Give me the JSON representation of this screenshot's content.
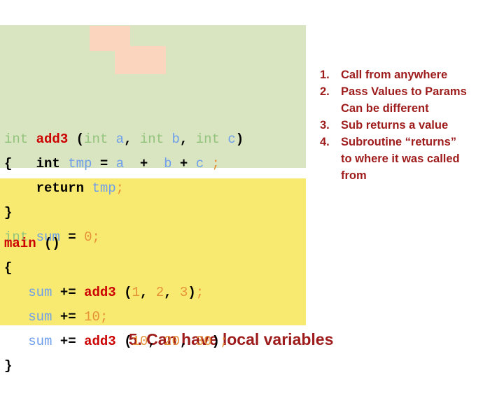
{
  "colors": {
    "func_block_bg": "#d9e4c0",
    "main_block_bg": "#f8ea70",
    "highlight_bg": "#fbd5bd",
    "note_text": "#9e1b1b",
    "type_keyword": "#93c47d",
    "function_name": "#cc0000",
    "variable": "#6d9eeb",
    "number": "#e69138",
    "punctuation": "#000000"
  },
  "code_function": {
    "lines": [
      {
        "id": "sig",
        "tokens": [
          {
            "text": "int",
            "cls": "t-type"
          },
          {
            "text": " ",
            "cls": "t-plain"
          },
          {
            "text": "add3",
            "cls": "t-fn"
          },
          {
            "text": " ",
            "cls": "t-plain"
          },
          {
            "text": "(",
            "cls": "t-punct"
          },
          {
            "text": "int",
            "cls": "t-type"
          },
          {
            "text": " ",
            "cls": "t-plain"
          },
          {
            "text": "a",
            "cls": "t-var"
          },
          {
            "text": ",",
            "cls": "t-punct"
          },
          {
            "text": " ",
            "cls": "t-plain"
          },
          {
            "text": "int",
            "cls": "t-type"
          },
          {
            "text": " ",
            "cls": "t-plain"
          },
          {
            "text": "b",
            "cls": "t-var"
          },
          {
            "text": ",",
            "cls": "t-punct"
          },
          {
            "text": " ",
            "cls": "t-plain"
          },
          {
            "text": "int",
            "cls": "t-type"
          },
          {
            "text": " ",
            "cls": "t-plain"
          },
          {
            "text": "c",
            "cls": "t-var"
          },
          {
            "text": ")",
            "cls": "t-punct"
          }
        ]
      },
      {
        "id": "decl",
        "tokens": [
          {
            "text": "{",
            "cls": "t-punct"
          },
          {
            "text": "   ",
            "cls": "t-plain"
          },
          {
            "text": "int",
            "cls": "t-kw"
          },
          {
            "text": " ",
            "cls": "t-plain"
          },
          {
            "text": "tmp",
            "cls": "t-var"
          },
          {
            "text": " = ",
            "cls": "t-op"
          },
          {
            "text": "a",
            "cls": "t-var"
          },
          {
            "text": "  +  ",
            "cls": "t-op"
          },
          {
            "text": "b",
            "cls": "t-var"
          },
          {
            "text": " + ",
            "cls": "t-op"
          },
          {
            "text": "c",
            "cls": "t-var"
          },
          {
            "text": " ",
            "cls": "t-plain"
          },
          {
            "text": ";",
            "cls": "t-semi"
          }
        ]
      },
      {
        "id": "return",
        "tokens": [
          {
            "text": "    ",
            "cls": "t-plain"
          },
          {
            "text": "return",
            "cls": "t-kw"
          },
          {
            "text": " ",
            "cls": "t-plain"
          },
          {
            "text": "tmp",
            "cls": "t-var"
          },
          {
            "text": ";",
            "cls": "t-semi"
          }
        ]
      },
      {
        "id": "close",
        "tokens": [
          {
            "text": "}",
            "cls": "t-punct"
          }
        ]
      },
      {
        "id": "global",
        "tokens": [
          {
            "text": "int",
            "cls": "t-type"
          },
          {
            "text": " ",
            "cls": "t-plain"
          },
          {
            "text": "sum",
            "cls": "t-var"
          },
          {
            "text": " = ",
            "cls": "t-op"
          },
          {
            "text": "0",
            "cls": "t-num"
          },
          {
            "text": ";",
            "cls": "t-semi"
          }
        ]
      }
    ]
  },
  "code_main": {
    "lines": [
      {
        "id": "main-sig",
        "tokens": [
          {
            "text": "main",
            "cls": "t-fn"
          },
          {
            "text": " ",
            "cls": "t-plain"
          },
          {
            "text": "()",
            "cls": "t-punct"
          }
        ]
      },
      {
        "id": "main-open",
        "tokens": [
          {
            "text": "{",
            "cls": "t-punct"
          }
        ]
      },
      {
        "id": "call1",
        "tokens": [
          {
            "text": "   ",
            "cls": "t-plain"
          },
          {
            "text": "sum",
            "cls": "t-var"
          },
          {
            "text": " ",
            "cls": "t-plain"
          },
          {
            "text": "+=",
            "cls": "t-op"
          },
          {
            "text": " ",
            "cls": "t-plain"
          },
          {
            "text": "add3",
            "cls": "t-fn"
          },
          {
            "text": " ",
            "cls": "t-plain"
          },
          {
            "text": "(",
            "cls": "t-punct"
          },
          {
            "text": "1",
            "cls": "t-num"
          },
          {
            "text": ",",
            "cls": "t-punct"
          },
          {
            "text": " ",
            "cls": "t-plain"
          },
          {
            "text": "2",
            "cls": "t-num"
          },
          {
            "text": ",",
            "cls": "t-punct"
          },
          {
            "text": " ",
            "cls": "t-plain"
          },
          {
            "text": "3",
            "cls": "t-num"
          },
          {
            "text": ")",
            "cls": "t-punct"
          },
          {
            "text": ";",
            "cls": "t-semi"
          }
        ]
      },
      {
        "id": "call2",
        "tokens": [
          {
            "text": "   ",
            "cls": "t-plain"
          },
          {
            "text": "sum",
            "cls": "t-var"
          },
          {
            "text": " ",
            "cls": "t-plain"
          },
          {
            "text": "+=",
            "cls": "t-op"
          },
          {
            "text": " ",
            "cls": "t-plain"
          },
          {
            "text": "10",
            "cls": "t-num"
          },
          {
            "text": ";",
            "cls": "t-semi"
          }
        ]
      },
      {
        "id": "call3",
        "tokens": [
          {
            "text": "   ",
            "cls": "t-plain"
          },
          {
            "text": "sum",
            "cls": "t-var"
          },
          {
            "text": " ",
            "cls": "t-plain"
          },
          {
            "text": "+=",
            "cls": "t-op"
          },
          {
            "text": " ",
            "cls": "t-plain"
          },
          {
            "text": "add3",
            "cls": "t-fn"
          },
          {
            "text": " ",
            "cls": "t-plain"
          },
          {
            "text": "(",
            "cls": "t-punct"
          },
          {
            "text": "10",
            "cls": "t-num"
          },
          {
            "text": ",",
            "cls": "t-punct"
          },
          {
            "text": " ",
            "cls": "t-plain"
          },
          {
            "text": "20",
            "cls": "t-num"
          },
          {
            "text": ",",
            "cls": "t-punct"
          },
          {
            "text": " ",
            "cls": "t-plain"
          },
          {
            "text": "30",
            "cls": "t-num"
          },
          {
            "text": ")",
            "cls": "t-punct"
          },
          {
            "text": ";",
            "cls": "t-semi"
          }
        ]
      },
      {
        "id": "main-close",
        "tokens": [
          {
            "text": "}",
            "cls": "t-punct"
          }
        ]
      }
    ]
  },
  "notes": {
    "items": [
      {
        "number": "1.",
        "text": "Call from anywhere",
        "continuations": []
      },
      {
        "number": "2.",
        "text": "Pass Values to Params",
        "continuations": [
          "Can be different"
        ]
      },
      {
        "number": "3.",
        "text": "Sub returns a value",
        "continuations": []
      },
      {
        "number": "4.",
        "text": "Subroutine “returns”",
        "continuations": [
          "to where it was called",
          "from"
        ]
      }
    ]
  },
  "footer": {
    "text": "5. Can have local variables"
  }
}
